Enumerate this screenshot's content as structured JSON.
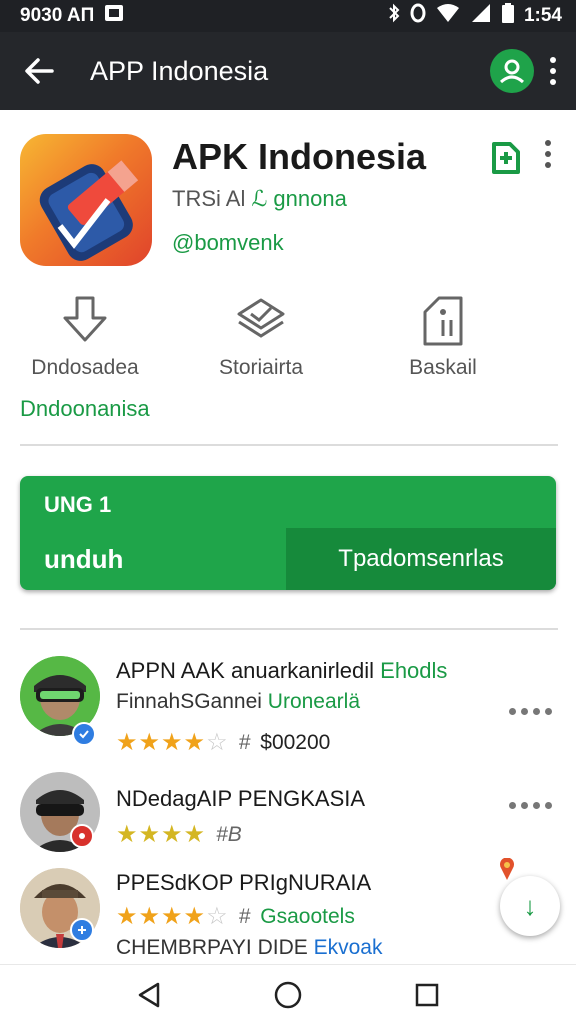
{
  "status_bar": {
    "left_text": "9030 AП",
    "time": "1:54",
    "icons": [
      "image-icon",
      "bluetooth-icon",
      "sync-icon",
      "wifi-icon",
      "signal-icon",
      "battery-icon"
    ]
  },
  "app_bar": {
    "title": "APP Indonesia",
    "icons": [
      "back-arrow-icon",
      "account-icon",
      "more-vert-icon"
    ]
  },
  "app": {
    "name": "APK Indonesia",
    "subtitle_part1": "TRSi Al ",
    "subtitle_part2": "ℒ gnnona",
    "developer": "@bomvenk"
  },
  "stats": [
    {
      "label": "Dndosadea",
      "icon": "download-arrow-icon"
    },
    {
      "label": "Storiairta",
      "icon": "layers-icon"
    },
    {
      "label": "Baskail",
      "icon": "info-bookmark-icon"
    }
  ],
  "category": "Dndoonanisa",
  "install_card": {
    "label": "UNG 1",
    "download_label": "unduh",
    "secondary_label": "Tpadomsenrlas",
    "color": "#1fa54a"
  },
  "list": [
    {
      "title": "APPN AAK anuarkanirledil ",
      "title_green": "Ehodls",
      "sub": "FinnahSGannei ",
      "sub_green": "Uronearlä",
      "hash": "#",
      "price": "$00200",
      "stars_on": "★★★",
      "stars_half": "★",
      "stars_off": "☆"
    },
    {
      "title": "NDedagAIP PENGKASIA",
      "hash": "#B",
      "stars_on": "★★★",
      "stars_half": "★",
      "stars_off": ""
    },
    {
      "title": "PPESdKOP PRIgNURAIA",
      "hash": "#",
      "rating_text": "Gsaootels",
      "sub": "CHEMBRPAYI DIDE ",
      "sub_blue": "Ekvoak",
      "stars_on": "★★★★",
      "stars_half": "",
      "stars_off": "☆"
    }
  ],
  "fab": {
    "label": "↓"
  },
  "nav": [
    "back-triangle-icon",
    "home-circle-icon",
    "recents-square-icon"
  ]
}
